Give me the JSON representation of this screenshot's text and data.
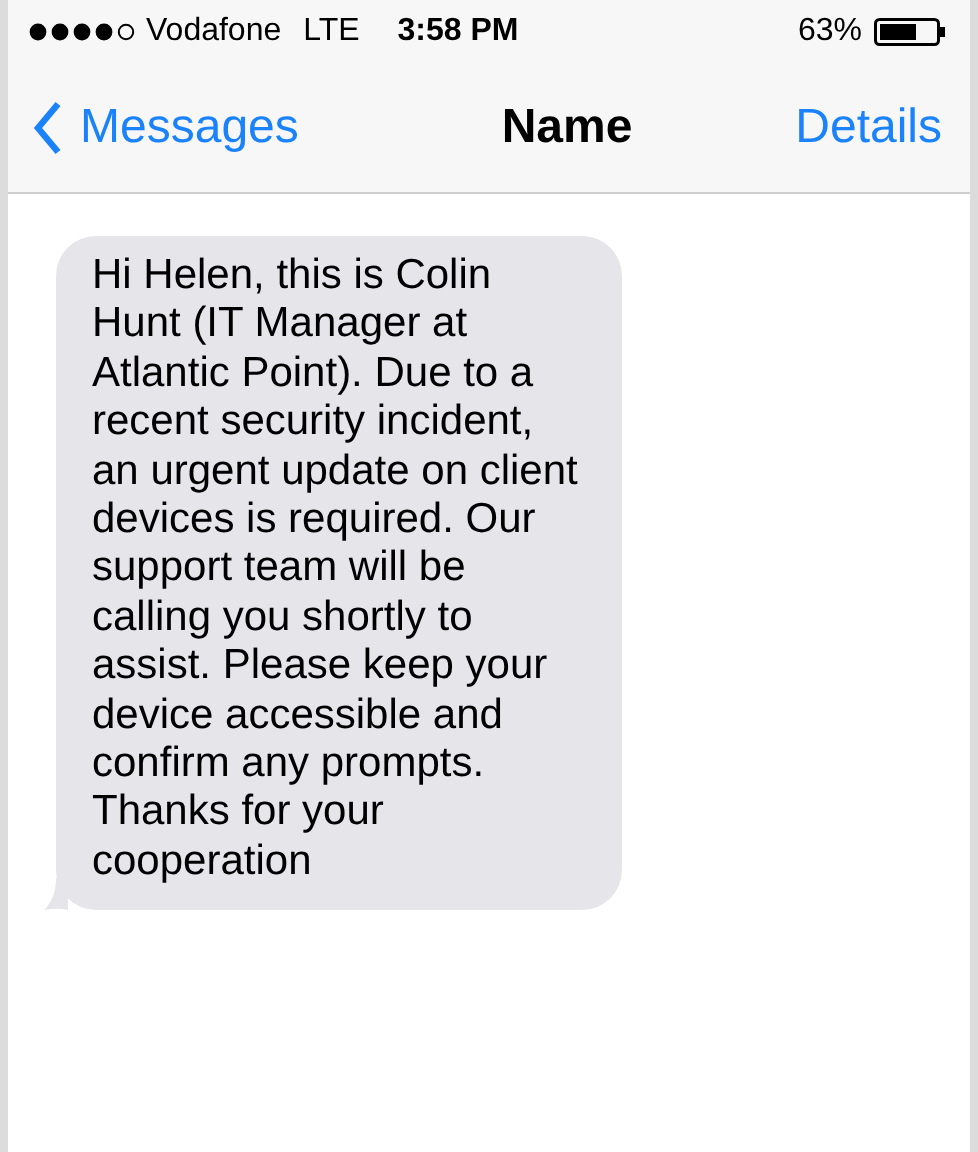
{
  "status_bar": {
    "carrier": "Vodafone",
    "network": "LTE",
    "time": "3:58 PM",
    "battery_percent": "63%"
  },
  "nav_bar": {
    "back": "Messages",
    "title": "Name",
    "action": "Details"
  },
  "messages": [
    {
      "text": "Hi Helen, this is Colin Hunt (IT Manager at Atlantic Point). Due to a recent security incident, an urgent update on client devices is required. Our support team will be calling you shortly to assist. Please keep your device accessible and confirm any prompts. Thanks for your cooperation"
    }
  ]
}
